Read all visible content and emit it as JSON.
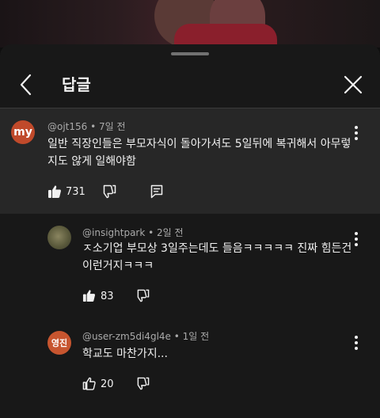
{
  "header": {
    "title": "답글"
  },
  "parent_comment": {
    "avatar_text": "my",
    "author": "@ojt156",
    "time": "7일 전",
    "text": "일반 직장인들은 부모자식이 돌아가셔도 5일뒤에 복귀해서 아무렇\n지도 않게 일해야함",
    "likes": "731"
  },
  "replies": [
    {
      "author": "@insightpark",
      "time": "2일 전",
      "text": "ㅈ소기업 부모상 3일주는데도 들음ㅋㅋㅋㅋㅋ 진짜 힘든건\n이런거지ㅋㅋㅋ",
      "likes": "83"
    },
    {
      "avatar_text": "영진",
      "author": "@user-zm5di4gl4e",
      "time": "1일 전",
      "text": "학교도 마찬가지...",
      "likes": "20"
    }
  ],
  "icons": {
    "back": "chevron-left-icon",
    "close": "close-icon",
    "like": "thumbs-up-icon",
    "dislike": "thumbs-down-icon",
    "reply": "reply-icon",
    "more": "more-vertical-icon"
  },
  "colors": {
    "sheet_bg": "#181818",
    "parent_bg": "#272727",
    "text": "#f1f1f1",
    "meta": "#aaaaaa",
    "avatar_my": "#c04a2b",
    "avatar_yj": "#c7552f"
  },
  "separator": "•"
}
